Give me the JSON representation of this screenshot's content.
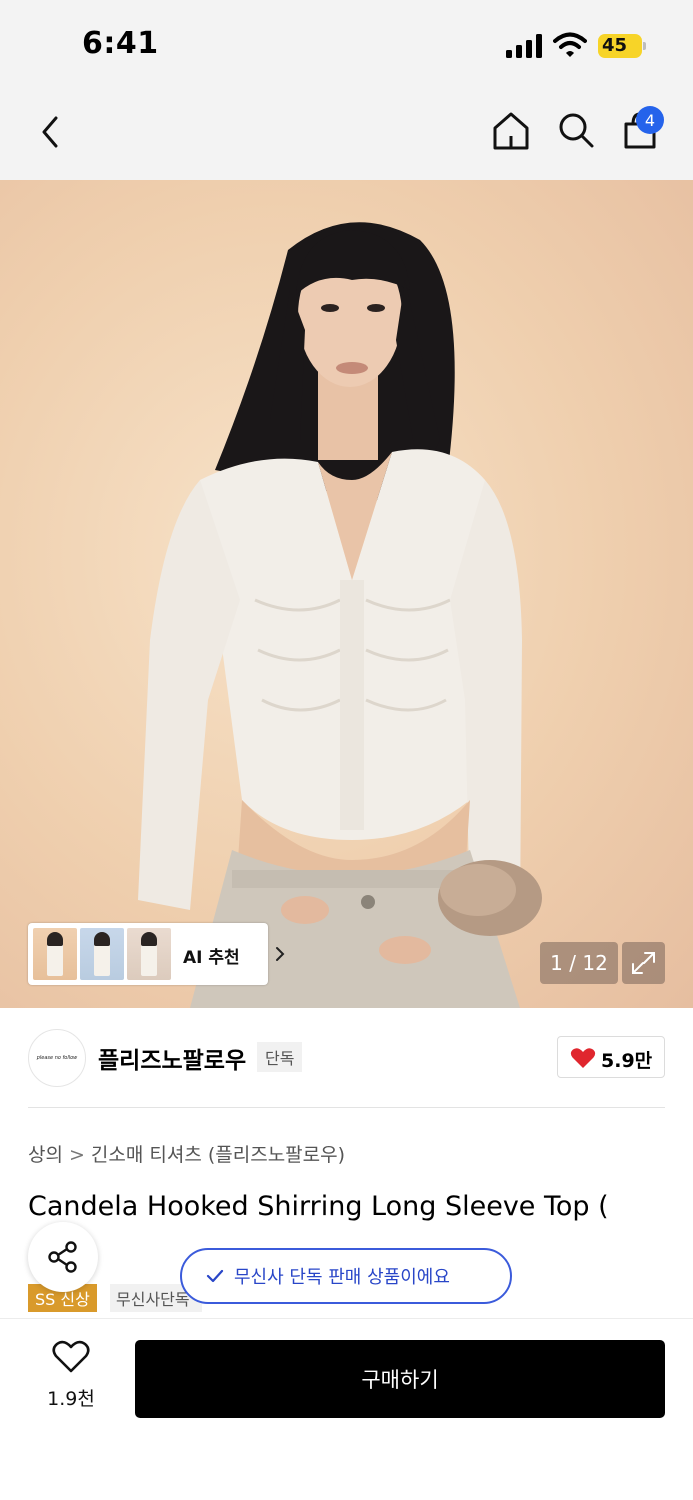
{
  "status_bar": {
    "time": "6:41",
    "battery": "45"
  },
  "nav": {
    "cart_count": "4"
  },
  "gallery": {
    "ai_recommend_label": "AI 추천",
    "counter": "1 / 12"
  },
  "brand": {
    "name": "플리즈노팔로우",
    "exclusive_tag": "단독",
    "likes": "5.9만",
    "like_color": "#e0262e"
  },
  "product": {
    "breadcrumb": [
      "상의",
      "긴소매 티셔츠 (플리즈노팔로우)"
    ],
    "title": "Candela Hooked Shirring Long Sleeve Top (",
    "title_line2": "    )",
    "badges": {
      "ss_new": "SS 신상",
      "musinsa_exclusive": "무신사단독"
    },
    "toast": "무신사 단독 판매 상품이에요"
  },
  "bottom_bar": {
    "wish_count": "1.9천",
    "buy_label": "구매하기"
  },
  "colors": {
    "accent_blue": "#2563eb",
    "ss_badge": "#d99a2b"
  }
}
